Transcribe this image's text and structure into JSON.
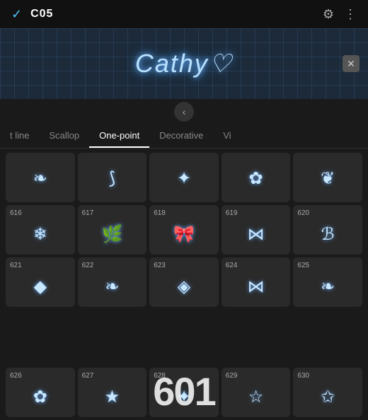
{
  "topBar": {
    "checkLabel": "✓",
    "title": "C05",
    "gearIcon": "⚙",
    "dotsIcon": "⋮"
  },
  "preview": {
    "text": "Cathy♡",
    "clearIcon": "✕"
  },
  "backBtn": "‹",
  "tabs": [
    {
      "label": "t line",
      "active": false
    },
    {
      "label": "Scallop",
      "active": false
    },
    {
      "label": "One-point",
      "active": true
    },
    {
      "label": "Decorative",
      "active": false
    },
    {
      "label": "Vi",
      "active": false
    }
  ],
  "cells": [
    {
      "num": "",
      "icon": "❧"
    },
    {
      "num": "",
      "icon": "⟆"
    },
    {
      "num": "",
      "icon": "✦"
    },
    {
      "num": "",
      "icon": "✿"
    },
    {
      "num": "",
      "icon": "❦"
    },
    {
      "num": "616",
      "icon": "❄"
    },
    {
      "num": "617",
      "icon": "🌿"
    },
    {
      "num": "618",
      "icon": "🎀"
    },
    {
      "num": "619",
      "icon": "⋈"
    },
    {
      "num": "620",
      "icon": "ℬ"
    },
    {
      "num": "621",
      "icon": "◆"
    },
    {
      "num": "622",
      "icon": "❧"
    },
    {
      "num": "623",
      "icon": "◈"
    },
    {
      "num": "624",
      "icon": "⋈"
    },
    {
      "num": "625",
      "icon": "❧"
    },
    {
      "num": "626",
      "icon": "✿"
    },
    {
      "num": "627",
      "icon": "★"
    },
    {
      "num": "628",
      "icon": "✦"
    },
    {
      "num": "629",
      "icon": "☆"
    },
    {
      "num": "630",
      "icon": "✩"
    }
  ],
  "bigNumber": "601"
}
